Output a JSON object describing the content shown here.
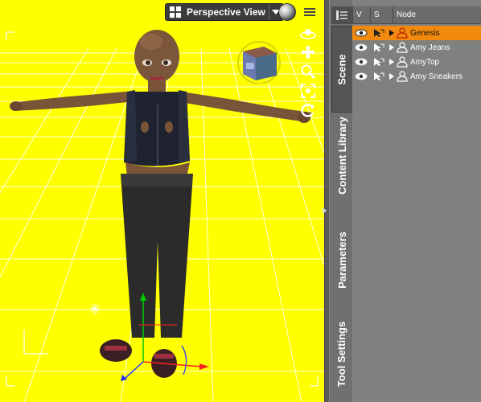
{
  "viewport": {
    "view_label": "Perspective View",
    "icons": {
      "view_grid": "viewport-layout-icon",
      "dropdown": "chevron-down-icon",
      "render_style": "shading-sphere-icon",
      "menu": "viewport-menu-icon",
      "view_cube": "view-cube",
      "orbit": "orbit-icon",
      "pan": "pan-icon",
      "zoom": "zoom-icon",
      "frame": "frame-icon",
      "reset": "reset-view-icon"
    },
    "colors": {
      "background": "#ffff00",
      "grid": "#ffffff"
    }
  },
  "dock": {
    "tabs": [
      {
        "label": "Scene",
        "active": true
      },
      {
        "label": "Content Library",
        "active": false
      },
      {
        "label": "Parameters",
        "active": false
      },
      {
        "label": "Tool Settings",
        "active": false
      }
    ]
  },
  "scene": {
    "columns": {
      "visible": "V",
      "selectable": "S",
      "node": "Node"
    },
    "nodes": [
      {
        "name": "Genesis",
        "selected": true,
        "expandable": true
      },
      {
        "name": "Amy Jeans",
        "selected": false,
        "expandable": true
      },
      {
        "name": "AmyTop",
        "selected": false,
        "expandable": true
      },
      {
        "name": "Amy Sneakers",
        "selected": false,
        "expandable": true
      }
    ],
    "colors": {
      "selection": "#f28a0f"
    }
  }
}
